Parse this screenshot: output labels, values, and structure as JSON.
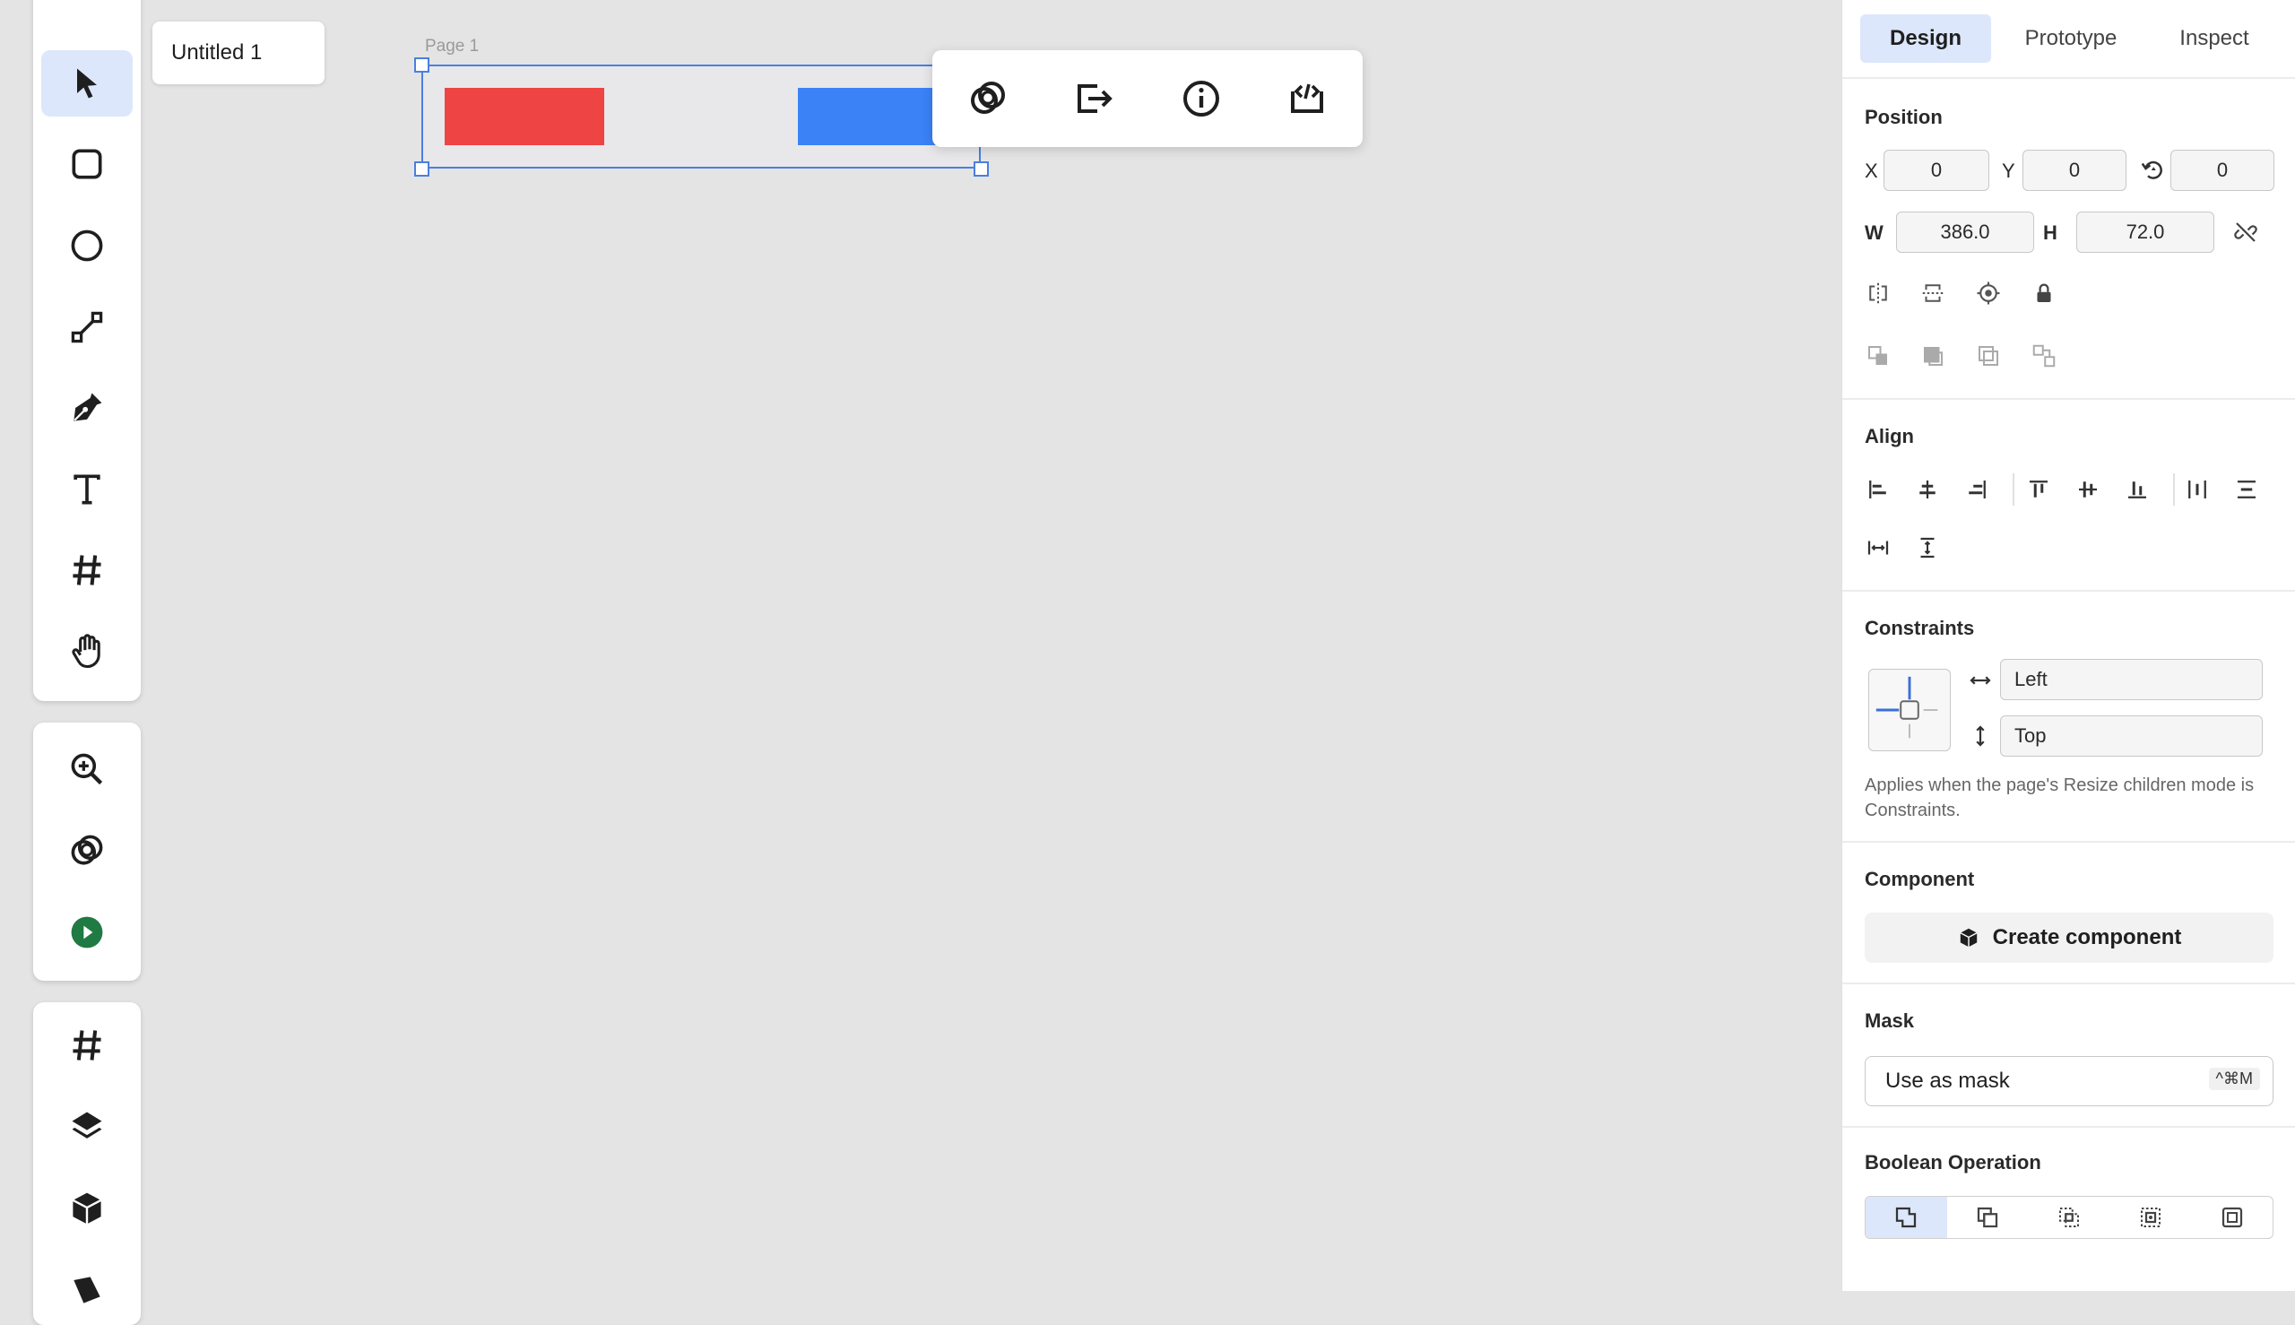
{
  "document": {
    "tab_title": "Untitled 1",
    "page_label": "Page 1"
  },
  "colors": {
    "canvas": "#e4e4e4",
    "accent": "#4a7fe0",
    "accent_soft": "#dde7fb",
    "red_shape": "#ef4444",
    "blue_shape": "#3b82f6",
    "play_green": "#1f7a43"
  },
  "tools": [
    {
      "name": "select",
      "icon": "pointer-icon",
      "active": true
    },
    {
      "name": "rectangle",
      "icon": "rounded-square-icon"
    },
    {
      "name": "ellipse",
      "icon": "circle-icon"
    },
    {
      "name": "line",
      "icon": "line-icon"
    },
    {
      "name": "pen",
      "icon": "pen-nib-icon"
    },
    {
      "name": "text",
      "icon": "text-t-icon"
    },
    {
      "name": "frame",
      "icon": "hash-icon"
    },
    {
      "name": "hand",
      "icon": "hand-icon"
    }
  ],
  "secondary_tools": [
    "zoom-in-icon",
    "boolean-rings-icon",
    "play-circle-icon"
  ],
  "bottom_tools": [
    "hash-icon",
    "layers-icon",
    "component-cube-icon"
  ],
  "context_toolbar": [
    "boolean-rings-icon",
    "export-arrow-icon",
    "info-circle-icon",
    "code-embed-icon"
  ],
  "panel": {
    "tabs": [
      {
        "label": "Design",
        "active": true
      },
      {
        "label": "Prototype"
      },
      {
        "label": "Inspect"
      }
    ],
    "position": {
      "title": "Position",
      "x_label": "X",
      "x": "0",
      "y_label": "Y",
      "y": "0",
      "rotation": "0",
      "w_label": "W",
      "w": "386.0",
      "h_label": "H",
      "h": "72.0"
    },
    "align": {
      "title": "Align"
    },
    "constraints": {
      "title": "Constraints",
      "horizontal": "Left",
      "vertical": "Top",
      "note": "Applies when the page's Resize children mode is Constraints."
    },
    "component": {
      "title": "Component",
      "button": "Create component"
    },
    "mask": {
      "title": "Mask",
      "button": "Use as mask",
      "shortcut": "^⌘M"
    },
    "boolean": {
      "title": "Boolean Operation"
    }
  }
}
